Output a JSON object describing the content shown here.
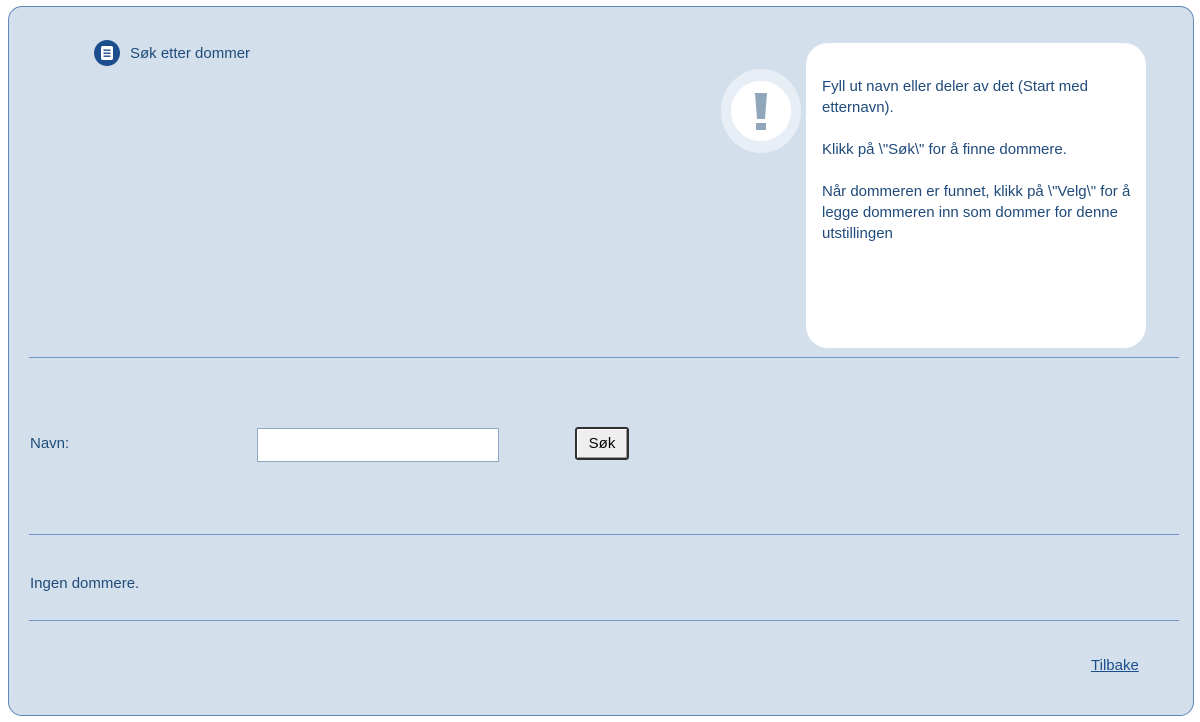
{
  "header": {
    "title": "Søk etter dommer",
    "icon": "document-icon"
  },
  "help": {
    "icon": "exclamation-icon",
    "paragraphs": [
      "Fyll ut navn eller deler av det (Start med etternavn).",
      "Klikk på \\\"Søk\\\" for å finne dommere.",
      "Når dommeren er funnet, klikk på \\\"Velg\\\" for å legge dommeren inn som dommer for denne utstillingen"
    ]
  },
  "form": {
    "name_label": "Navn:",
    "name_value": "",
    "search_button": "Søk"
  },
  "results": {
    "status": "Ingen dommere."
  },
  "footer": {
    "back_link": "Tilbake"
  },
  "colors": {
    "panel_bg": "#d3e0ec",
    "text": "#1f4a7a",
    "accent": "#1c4d8d",
    "border": "#5f87b6"
  }
}
